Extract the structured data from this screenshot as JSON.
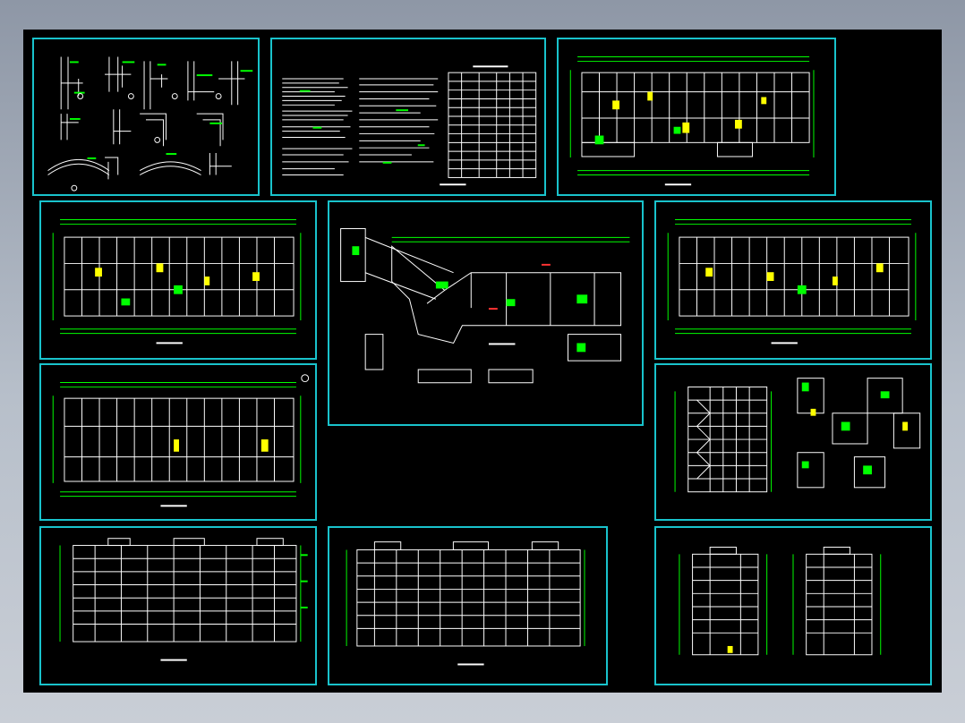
{
  "canvas": {
    "background": "#000000",
    "frame_color": "#19c3cc",
    "line_white": "#ffffff",
    "line_green": "#00ff00",
    "line_yellow": "#ffff00",
    "line_magenta": "#ff33ff",
    "line_red": "#ff3333"
  },
  "sheets": [
    {
      "id": "details",
      "kind": "details"
    },
    {
      "id": "notes",
      "kind": "notes"
    },
    {
      "id": "plan-top",
      "kind": "plan"
    },
    {
      "id": "plan-1",
      "kind": "plan"
    },
    {
      "id": "site-plan",
      "kind": "site"
    },
    {
      "id": "plan-2",
      "kind": "plan"
    },
    {
      "id": "plan-3",
      "kind": "plan"
    },
    {
      "id": "section-stair",
      "kind": "section"
    },
    {
      "id": "elev-front",
      "kind": "elevation"
    },
    {
      "id": "elev-rear",
      "kind": "elevation"
    },
    {
      "id": "elev-sides",
      "kind": "side-elevations"
    }
  ]
}
